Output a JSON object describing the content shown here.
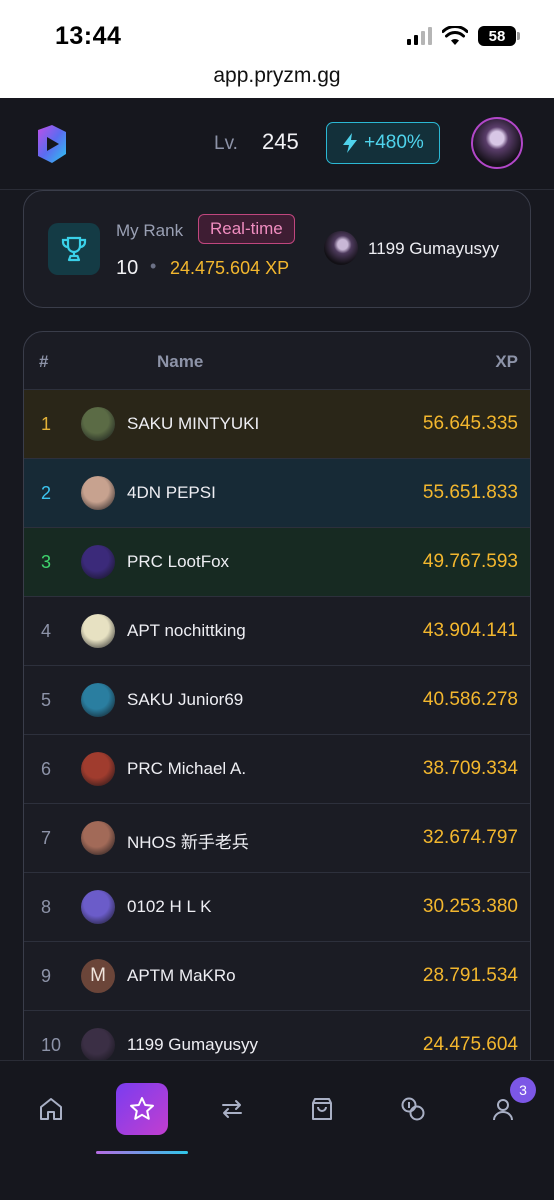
{
  "status_bar": {
    "time": "13:44",
    "battery": "58"
  },
  "browser": {
    "url": "app.pryzm.gg"
  },
  "header": {
    "level_label": "Lv.",
    "level_value": "245",
    "boost_label": "+480%"
  },
  "my_rank": {
    "label": "My Rank",
    "badge": "Real-time",
    "rank": "10",
    "separator": "•",
    "xp": "24.475.604 XP",
    "player_name": "1199 Gumayusyy"
  },
  "leaderboard": {
    "headers": {
      "rank": "#",
      "name": "Name",
      "xp": "XP"
    },
    "rows": [
      {
        "rank": "1",
        "name": "SAKU MINTYUKI",
        "xp": "56.645.335",
        "rank_color": "#e3b238",
        "bg": "#2a2618",
        "avatar": "#5b6b45"
      },
      {
        "rank": "2",
        "name": "4DN PEPSI",
        "xp": "55.651.833",
        "rank_color": "#3cc4ef",
        "bg": "#172a36",
        "avatar": "#c7a28f"
      },
      {
        "rank": "3",
        "name": "PRC LootFox",
        "xp": "49.767.593",
        "rank_color": "#3ed36d",
        "bg": "#172a22",
        "avatar": "#3b2a7a"
      },
      {
        "rank": "4",
        "name": "APT nochittking",
        "xp": "43.904.141",
        "avatar": "#e7e1c2"
      },
      {
        "rank": "5",
        "name": "SAKU Junior69",
        "xp": "40.586.278",
        "avatar": "#2a7ea0"
      },
      {
        "rank": "6",
        "name": "PRC Michael A.",
        "xp": "38.709.334",
        "avatar": "#a03c2e"
      },
      {
        "rank": "7",
        "name": "NHOS 新手老兵",
        "xp": "32.674.797",
        "avatar": "#a26a58"
      },
      {
        "rank": "8",
        "name": "0102 H L K",
        "xp": "30.253.380",
        "avatar": "#6b5cc9"
      },
      {
        "rank": "9",
        "name": "APTM MaKRo",
        "xp": "28.791.534",
        "avatar": "#6b4539",
        "initial": "M"
      },
      {
        "rank": "10",
        "name": "1199 Gumayusyy",
        "xp": "24.475.604",
        "avatar": "#3b2f45"
      }
    ]
  },
  "bottom_nav": {
    "items": [
      "home-icon",
      "star-icon",
      "swap-icon",
      "shop-bag-icon",
      "coins-icon",
      "profile-icon"
    ],
    "active": "star-icon",
    "profile_badge": "3"
  },
  "colors": {
    "accent_xp": "#f3b72e",
    "boost": "#4fd3ec",
    "realtime": "#f08dc0"
  }
}
